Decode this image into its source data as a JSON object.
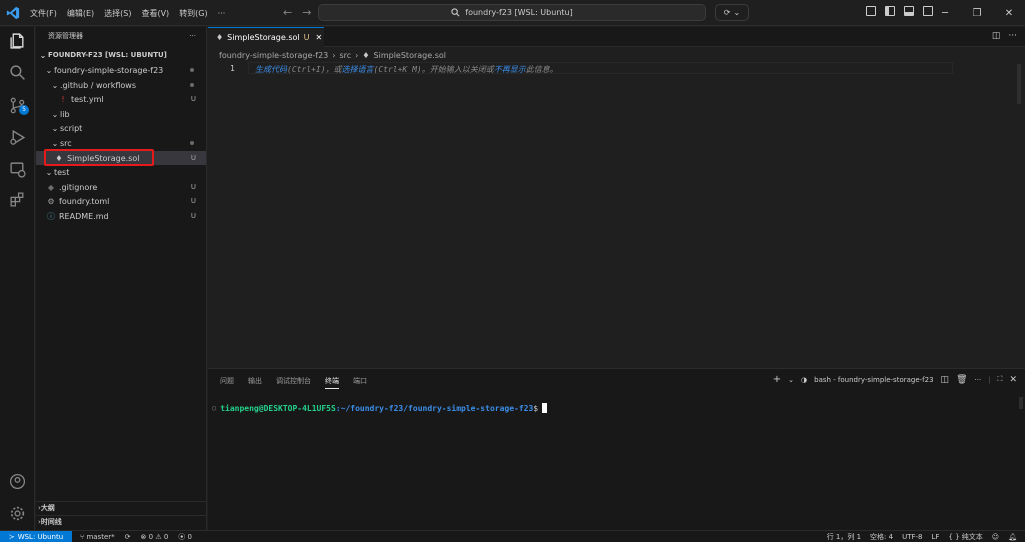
{
  "menu": [
    "文件(F)",
    "编辑(E)",
    "选择(S)",
    "查看(V)",
    "转到(G)",
    "···"
  ],
  "search": {
    "text": "foundry-f23 [WSL: Ubuntu]"
  },
  "sidebar": {
    "title": "资源管理器",
    "more": "···",
    "root": "FOUNDRY-F23 [WSL: UBUNTU]",
    "tree": [
      {
        "name": "foundry-simple-storage-f23",
        "status": "•"
      },
      {
        "name": ".github / workflows",
        "status": "•"
      },
      {
        "name": "test.yml",
        "status": "U"
      },
      {
        "name": "lib",
        "status": ""
      },
      {
        "name": "script",
        "status": ""
      },
      {
        "name": "src",
        "status": "•"
      },
      {
        "name": "SimpleStorage.sol",
        "status": "U"
      },
      {
        "name": "test",
        "status": ""
      },
      {
        "name": ".gitignore",
        "status": "U"
      },
      {
        "name": "foundry.toml",
        "status": "U"
      },
      {
        "name": "README.md",
        "status": "U"
      }
    ],
    "outline": "大纲",
    "timeline": "时间线"
  },
  "activity_badge": "5",
  "editor": {
    "tab_label": "SimpleStorage.sol",
    "tab_status": "U",
    "breadcrumb": [
      "foundry-simple-storage-f23",
      "src",
      "SimpleStorage.sol"
    ],
    "line_number": "1",
    "hint_a": "生成代码",
    "hint_b": "(Ctrl+I)，或",
    "hint_c": "选择语言",
    "hint_d": "(Ctrl+K M)。开始输入以关闭或",
    "hint_e": "不再显示",
    "hint_f": "此信息。"
  },
  "panel": {
    "tabs": [
      "问题",
      "输出",
      "调试控制台",
      "终端",
      "端口"
    ],
    "active_tab": "终端",
    "terminal_name": "bash - foundry-simple-storage-f23",
    "prompt": "tianpeng@DESKTOP-4L1UF5S",
    "path": ":~/foundry-f23/foundry-simple-storage-f23",
    "dollar": "$"
  },
  "statusbar": {
    "remote": "WSL: Ubuntu",
    "branch": "master*",
    "errors": "0",
    "warnings": "0",
    "ports": "0",
    "position": "行 1，列 1",
    "spaces": "空格: 4",
    "encoding": "UTF-8",
    "eol": "LF",
    "language": "{ } 纯文本"
  },
  "colors": {
    "accent": "#0078d4",
    "highlight_box": "#e51b1b",
    "terminal_green": "#23d18b",
    "terminal_blue": "#3b8eea"
  }
}
